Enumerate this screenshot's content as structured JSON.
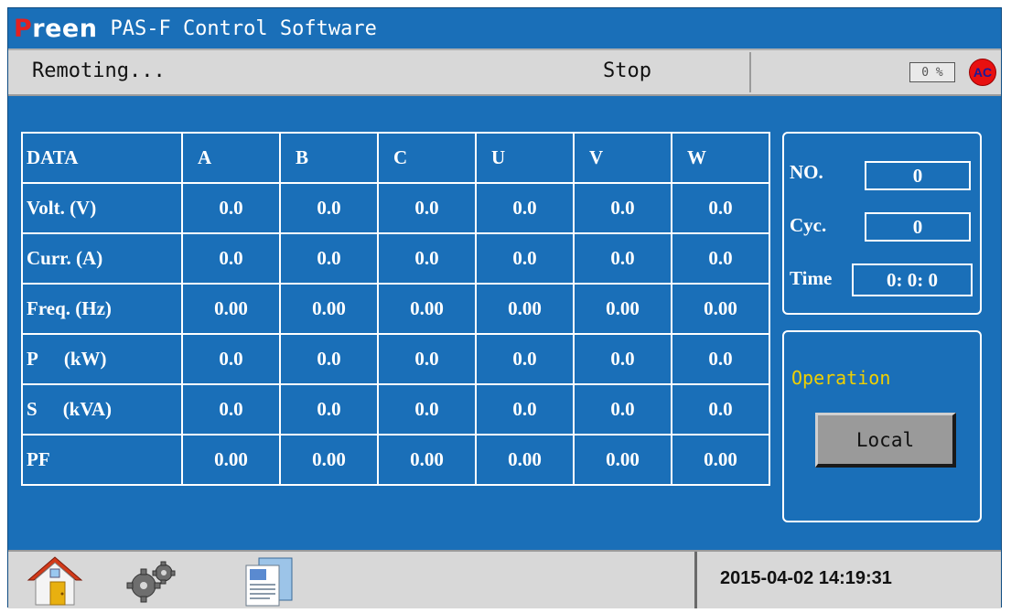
{
  "title": {
    "brand_first": "P",
    "brand_rest": "reen",
    "app_name": "PAS-F Control Software"
  },
  "status": {
    "left_text": "Remoting...",
    "mode_text": "Stop",
    "percent": "0 %",
    "ac_badge": "AC"
  },
  "table": {
    "headers": [
      "DATA",
      "A",
      "B",
      "C",
      "U",
      "V",
      "W"
    ],
    "rows": [
      {
        "label": "Volt. (V)",
        "values": [
          "0.0",
          "0.0",
          "0.0",
          "0.0",
          "0.0",
          "0.0"
        ]
      },
      {
        "label": "Curr. (A)",
        "values": [
          "0.0",
          "0.0",
          "0.0",
          "0.0",
          "0.0",
          "0.0"
        ]
      },
      {
        "label": "Freq. (Hz)",
        "values": [
          "0.00",
          "0.00",
          "0.00",
          "0.00",
          "0.00",
          "0.00"
        ]
      },
      {
        "label": "P",
        "unit": "(kW)",
        "values": [
          "0.0",
          "0.0",
          "0.0",
          "0.0",
          "0.0",
          "0.0"
        ]
      },
      {
        "label": "S",
        "unit": "(kVA)",
        "values": [
          "0.0",
          "0.0",
          "0.0",
          "0.0",
          "0.0",
          "0.0"
        ]
      },
      {
        "label": "PF",
        "values": [
          "0.00",
          "0.00",
          "0.00",
          "0.00",
          "0.00",
          "0.00"
        ]
      }
    ]
  },
  "counters": {
    "no_label": "NO.",
    "no_value": "0",
    "cyc_label": "Cyc.",
    "cyc_value": "0",
    "time_label": "Time",
    "time_value": "0: 0: 0"
  },
  "operation": {
    "label": "Operation",
    "button": "Local"
  },
  "bottom": {
    "datetime": "2015-04-02 14:19:31",
    "icons": [
      "home-icon",
      "settings-gears-icon",
      "documents-icon"
    ]
  },
  "colors": {
    "background": "#1a6fb8",
    "bar": "#d8d8d8",
    "brand_red": "#e32020",
    "op_label": "#f0d000",
    "ac_badge": "#e81010"
  }
}
